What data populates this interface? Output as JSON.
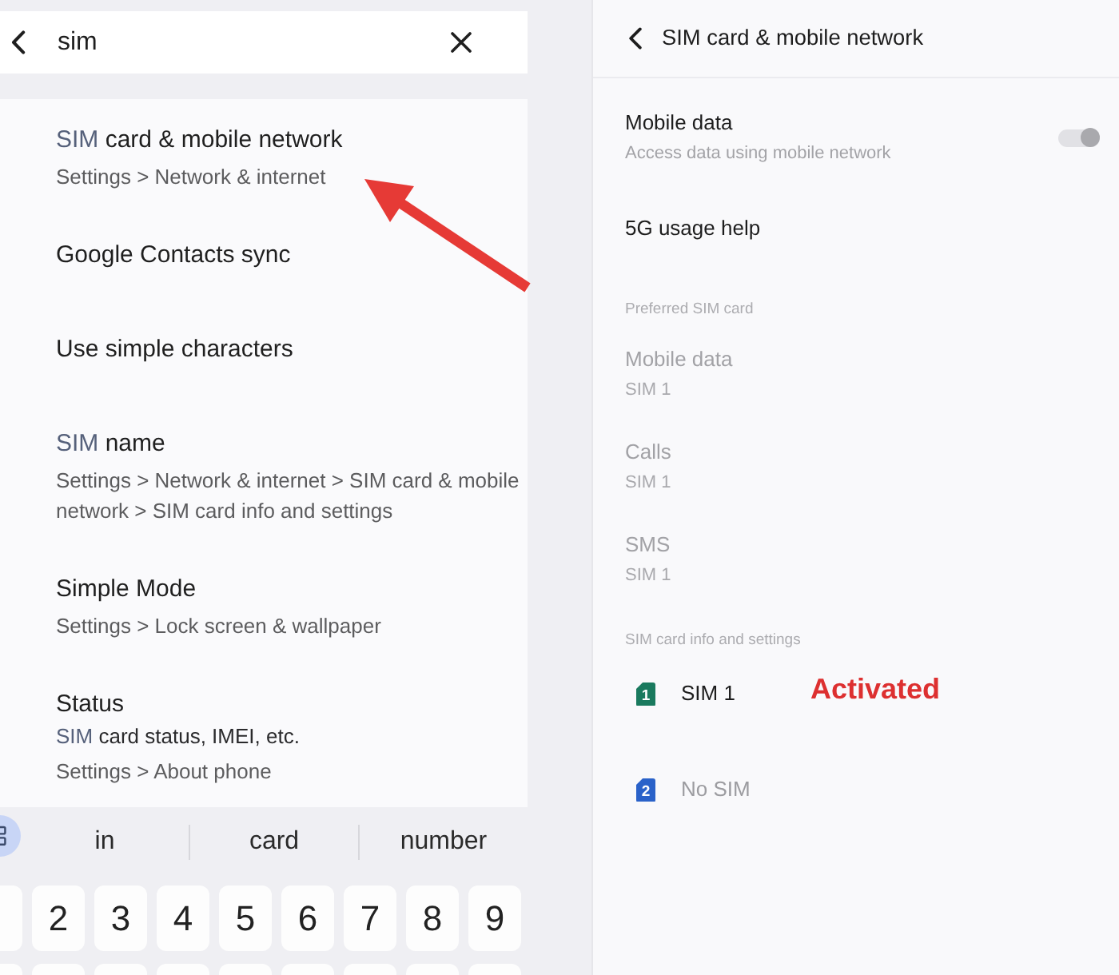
{
  "search": {
    "query": "sim"
  },
  "results": [
    {
      "title": [
        {
          "text": "SIM",
          "highlighted": true
        },
        {
          "text": " card & mobile network",
          "highlighted": false
        }
      ],
      "path": "Settings > Network & internet"
    },
    {
      "title": [
        {
          "text": "Google Contacts sync",
          "highlighted": false
        }
      ]
    },
    {
      "title": [
        {
          "text": "Use simple characters",
          "highlighted": false
        }
      ]
    },
    {
      "title": [
        {
          "text": "SIM",
          "highlighted": true
        },
        {
          "text": " name",
          "highlighted": false
        }
      ],
      "path": "Settings > Network & internet > SIM card & mobile network > SIM card info and settings"
    },
    {
      "title": [
        {
          "text": "Simple Mode",
          "highlighted": false
        }
      ],
      "path": "Settings > Lock screen & wallpaper"
    },
    {
      "title": [
        {
          "text": "Status",
          "highlighted": false
        }
      ],
      "summary": [
        {
          "text": "SIM",
          "highlighted": true
        },
        {
          "text": " card status, IMEI, etc.",
          "highlighted": false
        }
      ],
      "path": "Settings > About phone"
    }
  ],
  "keyboard": {
    "suggestions": [
      "in",
      "card",
      "number"
    ],
    "number_keys": [
      "2",
      "3",
      "4",
      "5",
      "6",
      "7",
      "8",
      "9"
    ]
  },
  "detail": {
    "title": "SIM card & mobile network",
    "rows": [
      {
        "kind": "toggle",
        "title": "Mobile data",
        "subtitle": "Access data using mobile network",
        "on": true,
        "disabled": true
      },
      {
        "kind": "link",
        "title": "5G usage help"
      },
      {
        "kind": "header",
        "title": "Preferred SIM card"
      },
      {
        "kind": "choice",
        "title": "Mobile data",
        "value": "SIM 1",
        "disabled": true
      },
      {
        "kind": "choice",
        "title": "Calls",
        "value": "SIM 1",
        "disabled": true
      },
      {
        "kind": "choice",
        "title": "SMS",
        "value": "SIM 1",
        "disabled": true
      },
      {
        "kind": "header",
        "title": "SIM card info and settings"
      },
      {
        "kind": "sim",
        "slot": "1",
        "label": "SIM 1",
        "color": "#1a7a5e",
        "disabled": false
      },
      {
        "kind": "sim",
        "slot": "2",
        "label": "No SIM",
        "color": "#2a62c9",
        "disabled": true
      }
    ]
  },
  "annotations": [
    {
      "kind": "arrow"
    },
    {
      "kind": "callout",
      "text": "Activated"
    }
  ]
}
